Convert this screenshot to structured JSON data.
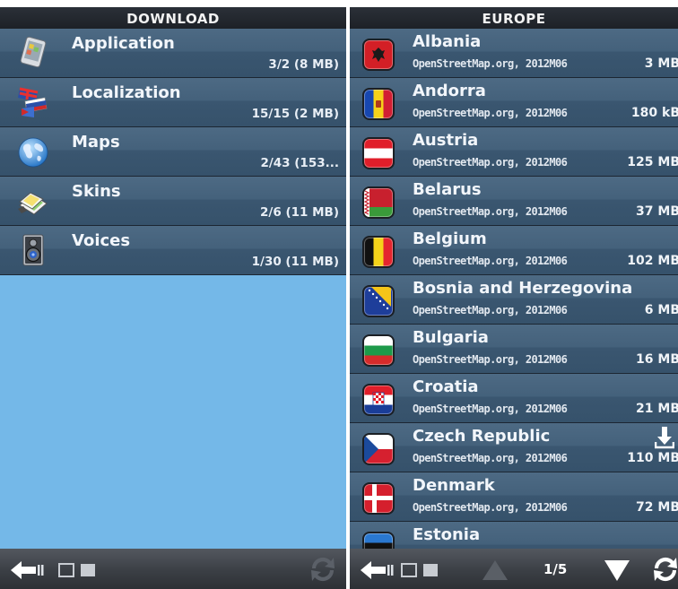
{
  "left": {
    "title": "DOWNLOAD",
    "items": [
      {
        "name": "Application",
        "amount": "3/2 (8 MB)",
        "icon": "application-icon"
      },
      {
        "name": "Localization",
        "amount": "15/15 (2 MB)",
        "icon": "localization-flags-icon"
      },
      {
        "name": "Maps",
        "amount": "2/43 (153...",
        "icon": "globe-icon"
      },
      {
        "name": "Skins",
        "amount": "2/6 (11 MB)",
        "icon": "skins-icon"
      },
      {
        "name": "Voices",
        "amount": "1/30 (11 MB)",
        "icon": "speaker-icon"
      }
    ]
  },
  "right": {
    "title": "EUROPE",
    "page": "1/5",
    "items": [
      {
        "name": "Albania",
        "source": "OpenStreetMap.org, 2012M06",
        "size": "3 MB"
      },
      {
        "name": "Andorra",
        "source": "OpenStreetMap.org, 2012M06",
        "size": "180 kB"
      },
      {
        "name": "Austria",
        "source": "OpenStreetMap.org, 2012M06",
        "size": "125 MB"
      },
      {
        "name": "Belarus",
        "source": "OpenStreetMap.org, 2012M06",
        "size": "37 MB"
      },
      {
        "name": "Belgium",
        "source": "OpenStreetMap.org, 2012M06",
        "size": "102 MB"
      },
      {
        "name": "Bosnia and Herzegovina",
        "source": "OpenStreetMap.org, 2012M06",
        "size": "6 MB"
      },
      {
        "name": "Bulgaria",
        "source": "OpenStreetMap.org, 2012M06",
        "size": "16 MB"
      },
      {
        "name": "Croatia",
        "source": "OpenStreetMap.org, 2012M06",
        "size": "21 MB"
      },
      {
        "name": "Czech Republic",
        "source": "OpenStreetMap.org, 2012M06",
        "size": "110 MB",
        "download_icon": "download-icon"
      },
      {
        "name": "Denmark",
        "source": "OpenStreetMap.org, 2012M06",
        "size": "72 MB"
      },
      {
        "name": "Estonia",
        "source": "",
        "size": ""
      }
    ]
  },
  "colors": {
    "background": "#74b8e8",
    "row": "#44617b",
    "header": "#23272e",
    "text": "#f2f6fb"
  },
  "icons": {
    "back": "back-arrow-icon",
    "view_toggle": "view-toggle-icon",
    "refresh": "refresh-icon",
    "page_up": "triangle-up-icon",
    "page_down": "triangle-down-icon"
  }
}
